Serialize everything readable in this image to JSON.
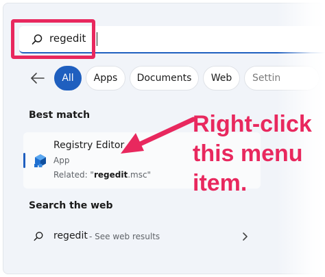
{
  "search": {
    "query": "regedit"
  },
  "filters": {
    "chips": [
      {
        "label": "All",
        "active": true
      },
      {
        "label": "Apps",
        "active": false
      },
      {
        "label": "Documents",
        "active": false
      },
      {
        "label": "Web",
        "active": false
      },
      {
        "label": "Settin",
        "active": false
      }
    ]
  },
  "best_match": {
    "section_label": "Best match",
    "app_name": "Registry Editor",
    "app_type": "App",
    "related_prefix": "Related: \"",
    "related_bold": "regedit",
    "related_suffix": ".msc\""
  },
  "web_search": {
    "section_label": "Search the web",
    "query": "regedit",
    "hint": " - See web results"
  },
  "annotation": {
    "text": "Right-click\nthis menu\nitem."
  },
  "colors": {
    "accent": "#1f5fbf",
    "annotation": "#e8285e",
    "panel_bg": "#f1f4f9"
  },
  "icons": {
    "search": "search-icon",
    "back": "back-arrow-icon",
    "app": "registry-editor-icon",
    "chevron": "chevron-right-icon"
  }
}
